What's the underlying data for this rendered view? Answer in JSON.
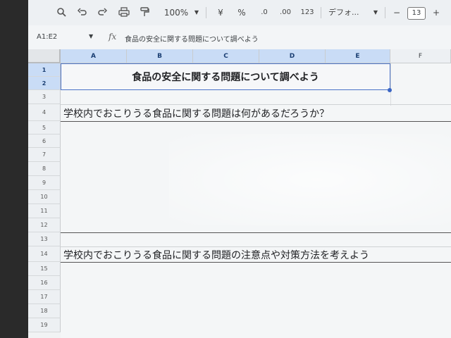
{
  "toolbar": {
    "zoom": "100%",
    "currency": "¥",
    "percent": "%",
    "dec_decrease": ".0",
    "dec_increase": ".00",
    "number_format": "123",
    "font": "デフォ...",
    "font_size": "13",
    "minus": "−",
    "plus": "+"
  },
  "formula_bar": {
    "name_box": "A1:E2",
    "formula": "食品の安全に関する問題について調べよう"
  },
  "columns": [
    "A",
    "B",
    "C",
    "D",
    "E",
    "F"
  ],
  "rows": [
    "1",
    "2",
    "3",
    "4",
    "5",
    "6",
    "7",
    "8",
    "9",
    "10",
    "11",
    "12",
    "13",
    "14",
    "15",
    "16",
    "17",
    "18",
    "19"
  ],
  "sheet": {
    "title": "食品の安全に関する問題について調べよう",
    "row4": "学校内でおこりうる食品に関する問題は何があるだろうか？",
    "row14": "学校内でおこりうる食品に関する問題の注意点や対策方法を考えよう"
  }
}
